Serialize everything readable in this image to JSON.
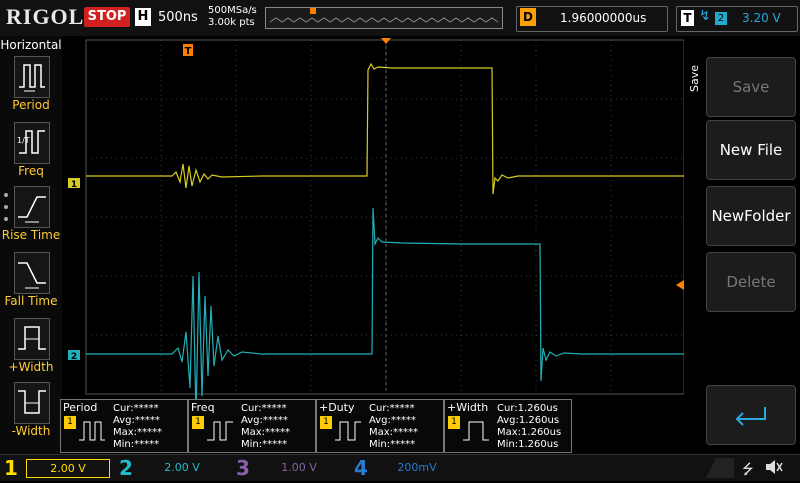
{
  "header": {
    "logo": "RIGOL",
    "run_state": "STOP",
    "horizontal_badge": "H",
    "timebase": "500ns",
    "sample_rate": "500MSa/s",
    "memory_depth": "3.00k pts",
    "delay_badge": "D",
    "delay_value": "1.96000000us",
    "trigger_badge": "T",
    "trigger_channel": "2",
    "trigger_level": "3.20 V"
  },
  "left_panel": {
    "title": "Horizontal",
    "items": [
      {
        "label": "Period"
      },
      {
        "label": "Freq"
      },
      {
        "label": "Rise Time"
      },
      {
        "label": "Fall Time"
      },
      {
        "label": "+Width"
      },
      {
        "label": "-Width"
      }
    ]
  },
  "side_menu": {
    "title": "Save",
    "buttons": [
      {
        "label": "Save",
        "enabled": false
      },
      {
        "label": "New File",
        "enabled": true
      },
      {
        "label": "NewFolder",
        "enabled": true
      },
      {
        "label": "Delete",
        "enabled": false
      },
      {
        "label": "",
        "enabled": true
      }
    ]
  },
  "markers": {
    "trigger_pos": "T",
    "ch1": "1",
    "ch2": "2"
  },
  "measurements": [
    {
      "name": "Period",
      "ch": "1",
      "cur": "Cur:*****",
      "avg": "Avg:*****",
      "max": "Max:*****",
      "min": "Min:*****"
    },
    {
      "name": "Freq",
      "ch": "1",
      "cur": "Cur:*****",
      "avg": "Avg:*****",
      "max": "Max:*****",
      "min": "Min:*****"
    },
    {
      "name": "+Duty",
      "ch": "1",
      "cur": "Cur:*****",
      "avg": "Avg:*****",
      "max": "Max:*****",
      "min": "Min:*****"
    },
    {
      "name": "+Width",
      "ch": "1",
      "cur": "Cur:1.260us",
      "avg": "Avg:1.260us",
      "max": "Max:1.260us",
      "min": "Min:1.260us"
    }
  ],
  "channels": [
    {
      "num": "1",
      "scale": "2.00 V"
    },
    {
      "num": "2",
      "scale": "2.00 V"
    },
    {
      "num": "3",
      "scale": "1.00 V"
    },
    {
      "num": "4",
      "scale": "200mV"
    }
  ],
  "colors": {
    "ch1": "#d8cc20",
    "ch2": "#22b0b8",
    "ch3": "#8a5fa8",
    "ch4": "#2a7ad0",
    "trigger": "#ff8000",
    "stop": "#d02020"
  }
}
